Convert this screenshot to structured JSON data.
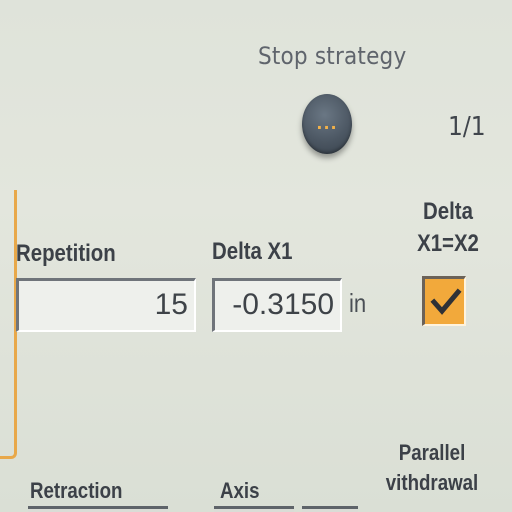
{
  "strategy": {
    "label": "Stop strategy",
    "page_indicator": "1/1",
    "more_icon": "..."
  },
  "fields": {
    "repetition": {
      "label": "Repetition",
      "value": "15"
    },
    "delta_x1": {
      "label": "Delta X1",
      "value": "-0.3150",
      "unit": "in"
    },
    "delta_equal": {
      "label_line1": "Delta",
      "label_line2": "X1=X2",
      "checked": true
    }
  },
  "bottom": {
    "retraction_label": "Retraction",
    "axis_label": "Axis",
    "parallel_line1": "Parallel",
    "parallel_line2": "vithdrawal"
  },
  "colors": {
    "accent": "#f2a93b",
    "button": "#4c5763",
    "background": "#e0e3da"
  },
  "icons": {
    "more": "more-options-icon",
    "check": "checkmark-icon"
  }
}
